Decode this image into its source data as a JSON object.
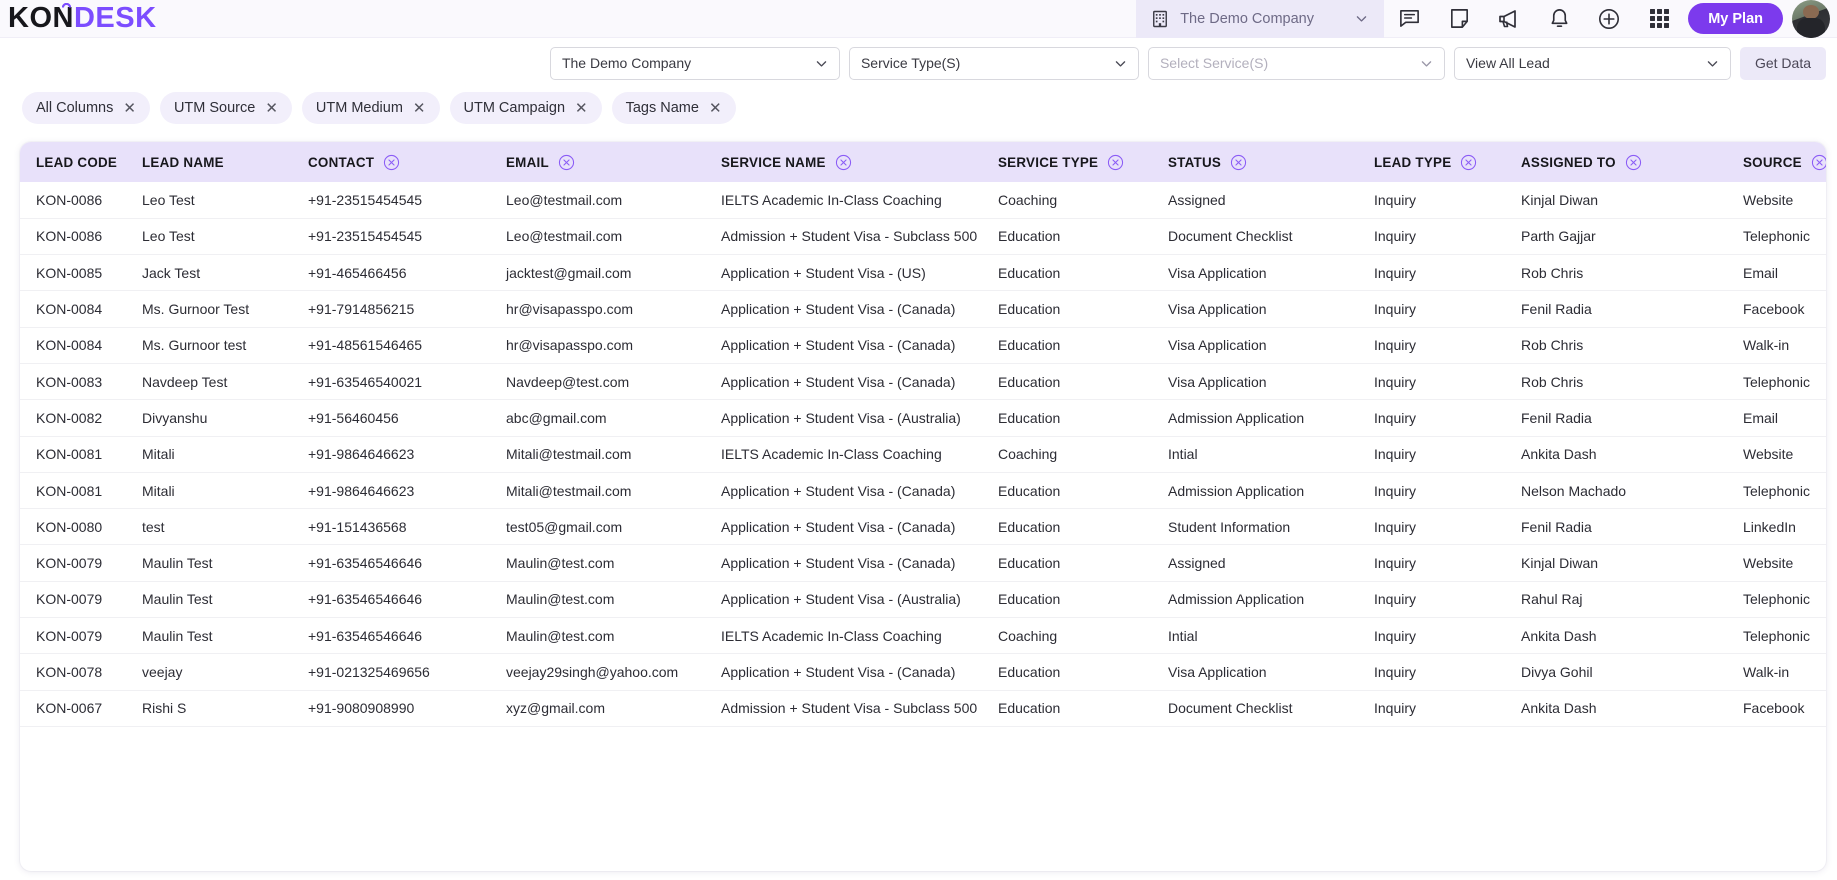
{
  "brand": {
    "part1": "KON",
    "part2": "DESK"
  },
  "header": {
    "company": "The Demo Company",
    "building_icon": "building-icon",
    "icons": [
      "chat-icon",
      "note-icon",
      "megaphone-icon",
      "bell-icon",
      "plus-icon",
      "apps-grid-icon"
    ],
    "my_plan_label": "My Plan",
    "accent_color": "#7c3aed"
  },
  "filters": {
    "company": {
      "value": "The Demo Company",
      "placeholder": "The Demo Company"
    },
    "service_type": {
      "value": "Service Type(S)",
      "placeholder": "Service Type(S)"
    },
    "service": {
      "value": "",
      "placeholder": "Select Service(S)"
    },
    "view": {
      "value": "View All Lead",
      "placeholder": "View All Lead"
    },
    "get_data_label": "Get Data"
  },
  "chips": [
    {
      "label": "All Columns",
      "close": "✕"
    },
    {
      "label": "UTM Source",
      "close": "✕"
    },
    {
      "label": "UTM Medium",
      "close": "✕"
    },
    {
      "label": "UTM Campaign",
      "close": "✕"
    },
    {
      "label": "Tags Name",
      "close": "✕"
    }
  ],
  "table": {
    "columns": [
      {
        "label": "LEAD CODE",
        "removable": false
      },
      {
        "label": "LEAD NAME",
        "removable": false
      },
      {
        "label": "CONTACT",
        "removable": true
      },
      {
        "label": "EMAIL",
        "removable": true
      },
      {
        "label": "SERVICE NAME",
        "removable": true
      },
      {
        "label": "SERVICE TYPE",
        "removable": true
      },
      {
        "label": "STATUS",
        "removable": true
      },
      {
        "label": "LEAD TYPE",
        "removable": true
      },
      {
        "label": "ASSIGNED TO",
        "removable": true
      },
      {
        "label": "SOURCE",
        "removable": true
      }
    ],
    "rows": [
      {
        "accent": false,
        "lead_code": "KON-0086",
        "lead_name": "Leo Test",
        "contact": "+91-23515454545",
        "email": "Leo@testmail.com",
        "service_name": "IELTS Academic In-Class Coaching",
        "service_type": "Coaching",
        "status": "Assigned",
        "lead_type": "Inquiry",
        "assigned_to": "Kinjal Diwan",
        "source": "Website"
      },
      {
        "accent": true,
        "lead_code": "KON-0086",
        "lead_name": "Leo Test",
        "contact": "+91-23515454545",
        "email": "Leo@testmail.com",
        "service_name": "Admission + Student Visa - Subclass 500",
        "service_type": "Education",
        "status": "Document Checklist",
        "lead_type": "Inquiry",
        "assigned_to": "Parth Gajjar",
        "source": "Telephonic"
      },
      {
        "accent": true,
        "lead_code": "KON-0085",
        "lead_name": "Jack Test",
        "contact": "+91-465466456",
        "email": "jacktest@gmail.com",
        "service_name": "Application + Student Visa - (US)",
        "service_type": "Education",
        "status": "Visa Application",
        "lead_type": "Inquiry",
        "assigned_to": "Rob Chris",
        "source": "Email"
      },
      {
        "accent": true,
        "lead_code": "KON-0084",
        "lead_name": "Ms. Gurnoor Test",
        "contact": "+91-7914856215",
        "email": "hr@visapasspo.com",
        "service_name": "Application + Student Visa - (Canada)",
        "service_type": "Education",
        "status": "Visa Application",
        "lead_type": "Inquiry",
        "assigned_to": "Fenil Radia",
        "source": "Facebook"
      },
      {
        "accent": true,
        "lead_code": "KON-0084",
        "lead_name": "Ms. Gurnoor test",
        "contact": "+91-48561546465",
        "email": "hr@visapasspo.com",
        "service_name": "Application + Student Visa - (Canada)",
        "service_type": "Education",
        "status": "Visa Application",
        "lead_type": "Inquiry",
        "assigned_to": "Rob Chris",
        "source": "Walk-in"
      },
      {
        "accent": true,
        "lead_code": "KON-0083",
        "lead_name": "Navdeep Test",
        "contact": "+91-63546540021",
        "email": "Navdeep@test.com",
        "service_name": "Application + Student Visa - (Canada)",
        "service_type": "Education",
        "status": "Visa Application",
        "lead_type": "Inquiry",
        "assigned_to": "Rob Chris",
        "source": "Telephonic"
      },
      {
        "accent": true,
        "lead_code": "KON-0082",
        "lead_name": "Divyanshu",
        "contact": "+91-56460456",
        "email": "abc@gmail.com",
        "service_name": "Application + Student Visa - (Australia)",
        "service_type": "Education",
        "status": "Admission Application",
        "lead_type": "Inquiry",
        "assigned_to": "Fenil Radia",
        "source": "Email"
      },
      {
        "accent": true,
        "lead_code": "KON-0081",
        "lead_name": "Mitali",
        "contact": "+91-9864646623",
        "email": "Mitali@testmail.com",
        "service_name": "IELTS Academic In-Class Coaching",
        "service_type": "Coaching",
        "status": "Intial",
        "lead_type": "Inquiry",
        "assigned_to": "Ankita Dash",
        "source": "Website"
      },
      {
        "accent": true,
        "lead_code": "KON-0081",
        "lead_name": "Mitali",
        "contact": "+91-9864646623",
        "email": "Mitali@testmail.com",
        "service_name": "Application + Student Visa - (Canada)",
        "service_type": "Education",
        "status": "Admission Application",
        "lead_type": "Inquiry",
        "assigned_to": "Nelson Machado",
        "source": "Telephonic"
      },
      {
        "accent": true,
        "lead_code": "KON-0080",
        "lead_name": "test",
        "contact": "+91-151436568",
        "email": "test05@gmail.com",
        "service_name": "Application + Student Visa - (Canada)",
        "service_type": "Education",
        "status": "Student Information",
        "lead_type": "Inquiry",
        "assigned_to": "Fenil Radia",
        "source": "LinkedIn"
      },
      {
        "accent": false,
        "lead_code": "KON-0079",
        "lead_name": "Maulin Test",
        "contact": "+91-63546546646",
        "email": "Maulin@test.com",
        "service_name": "Application + Student Visa - (Canada)",
        "service_type": "Education",
        "status": "Assigned",
        "lead_type": "Inquiry",
        "assigned_to": "Kinjal Diwan",
        "source": "Website"
      },
      {
        "accent": true,
        "lead_code": "KON-0079",
        "lead_name": "Maulin Test",
        "contact": "+91-63546546646",
        "email": "Maulin@test.com",
        "service_name": "Application + Student Visa - (Australia)",
        "service_type": "Education",
        "status": "Admission Application",
        "lead_type": "Inquiry",
        "assigned_to": "Rahul Raj",
        "source": "Telephonic"
      },
      {
        "accent": true,
        "lead_code": "KON-0079",
        "lead_name": "Maulin Test",
        "contact": "+91-63546546646",
        "email": "Maulin@test.com",
        "service_name": "IELTS Academic In-Class Coaching",
        "service_type": "Coaching",
        "status": "Intial",
        "lead_type": "Inquiry",
        "assigned_to": "Ankita Dash",
        "source": "Telephonic"
      },
      {
        "accent": true,
        "lead_code": "KON-0078",
        "lead_name": "veejay",
        "contact": "+91-021325469656",
        "email": "veejay29singh@yahoo.com",
        "service_name": "Application + Student Visa - (Canada)",
        "service_type": "Education",
        "status": "Visa Application",
        "lead_type": "Inquiry",
        "assigned_to": "Divya Gohil",
        "source": "Walk-in"
      },
      {
        "accent": true,
        "lead_code": "KON-0067",
        "lead_name": "Rishi S",
        "contact": "+91-9080908990",
        "email": "xyz@gmail.com",
        "service_name": "Admission + Student Visa - Subclass 500",
        "service_type": "Education",
        "status": "Document Checklist",
        "lead_type": "Inquiry",
        "assigned_to": "Ankita Dash",
        "source": "Facebook"
      }
    ]
  }
}
